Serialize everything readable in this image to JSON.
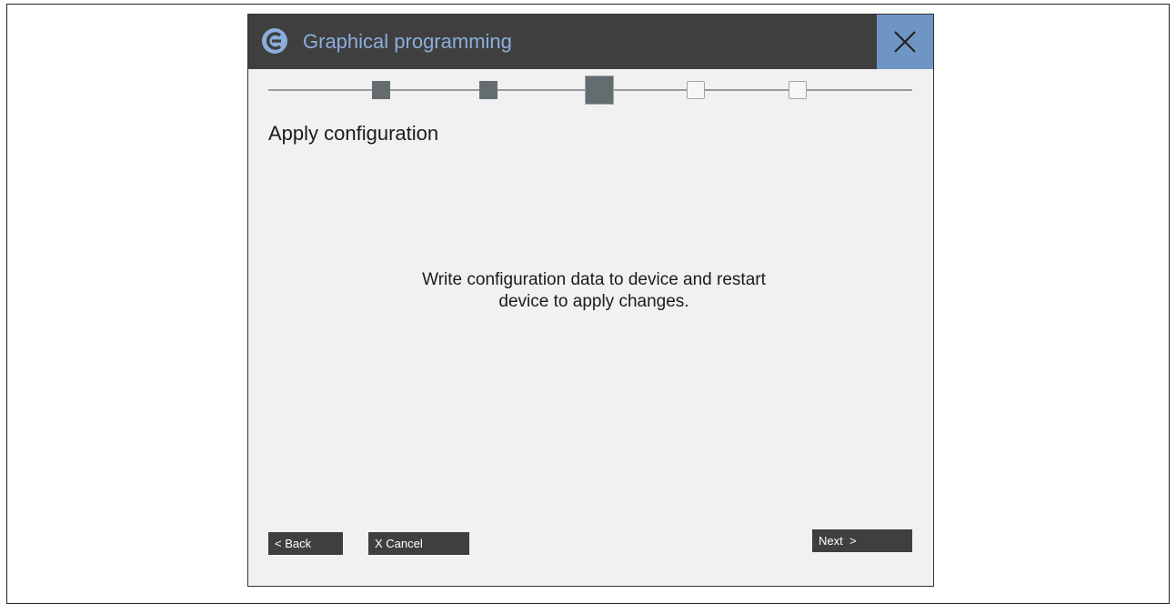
{
  "window": {
    "title": "Graphical programming",
    "logo_icon": "app-logo-icon",
    "close_icon": "close-icon",
    "title_bar_color": "#3f3f3f",
    "title_text_color": "#8aaedd",
    "close_button_color": "#6e95c4"
  },
  "wizard": {
    "steps": [
      {
        "state": "done"
      },
      {
        "state": "done"
      },
      {
        "state": "current"
      },
      {
        "state": "todo"
      },
      {
        "state": "todo"
      }
    ],
    "current_step": 3,
    "total_steps": 5
  },
  "page": {
    "heading": "Apply configuration",
    "message_line1": "Write configuration data to device and restart",
    "message_line2": "device to apply changes."
  },
  "buttons": {
    "back_label": "< Back",
    "cancel_label": "X Cancel",
    "next_label": "Next  >"
  }
}
